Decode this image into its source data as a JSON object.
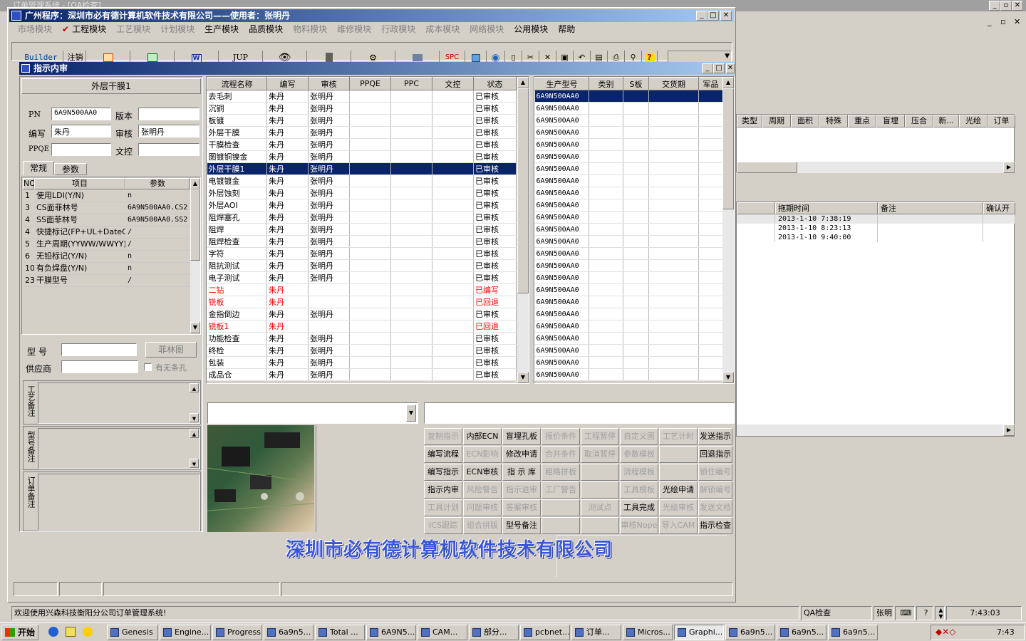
{
  "bg_title": "订单管理系统 - [QA检查]",
  "main_title": "广州程序：深圳市必有德计算机软件技术有限公司——使用者：张明丹",
  "menu": [
    {
      "label": "市场模块",
      "en": false
    },
    {
      "label": "工程模块",
      "en": true
    },
    {
      "label": "工艺模块",
      "en": false
    },
    {
      "label": "计划模块",
      "en": false
    },
    {
      "label": "生产模块",
      "en": true
    },
    {
      "label": "品质模块",
      "en": true
    },
    {
      "label": "物料模块",
      "en": false
    },
    {
      "label": "维修模块",
      "en": false
    },
    {
      "label": "行政模块",
      "en": false
    },
    {
      "label": "成本模块",
      "en": false
    },
    {
      "label": "网络模块",
      "en": false
    },
    {
      "label": "公用模块",
      "en": true
    },
    {
      "label": "帮助",
      "en": true
    }
  ],
  "toolbar": {
    "builder": "Builder",
    "logout": "注销",
    "w": "W",
    "jup": "JUP",
    "spc": "SPC"
  },
  "child_title": "指示内审",
  "left": {
    "header": "外层干膜1",
    "pn_label": "PN",
    "pn_value": "6A9N500AA0",
    "version_label": "版本",
    "version_value": "",
    "writer_label": "编写",
    "writer_value": "朱丹",
    "audit_label": "审核",
    "audit_value": "张明丹",
    "ppqe_label": "PPQE",
    "ppqe_value": "",
    "wenkong_label": "文控",
    "wenkong_value": "",
    "tab1": "常规",
    "tab2": "参数",
    "param_headers": [
      "NO",
      "项目",
      "参数"
    ],
    "params": [
      [
        "1",
        "使用LDI(Y/N)",
        "n"
      ],
      [
        "3",
        "CS面菲林号",
        "6A9N500AA0.CS2"
      ],
      [
        "4",
        "SS面菲林号",
        "6A9N500AA0.SS2"
      ],
      [
        "4",
        "快捷标记(FP+UL+DateC/",
        "/"
      ],
      [
        "5",
        "生产周期(YYWW/WWYY)",
        "/"
      ],
      [
        "6",
        "无铅标记(Y/N)",
        "n"
      ],
      [
        "10",
        "有负焊盘(Y/N)",
        "n"
      ],
      [
        "23",
        "干膜型号",
        "/"
      ]
    ],
    "model_label": "型 号",
    "film_btn": "菲林图",
    "supplier_label": "供应商",
    "slot_label": "有无条孔",
    "note1": "工艺备注",
    "note2": "型号备注",
    "note3": "订单备注"
  },
  "flow": {
    "headers": [
      "流程名称",
      "编写",
      "审核",
      "PPQE",
      "PPC",
      "文控",
      "状态"
    ],
    "rows": [
      [
        "去毛刺",
        "朱丹",
        "张明丹",
        "",
        "",
        "",
        "已审核"
      ],
      [
        "沉铜",
        "朱丹",
        "张明丹",
        "",
        "",
        "",
        "已审核"
      ],
      [
        "板镀",
        "朱丹",
        "张明丹",
        "",
        "",
        "",
        "已审核"
      ],
      [
        "外层干膜",
        "朱丹",
        "张明丹",
        "",
        "",
        "",
        "已审核"
      ],
      [
        "干膜检查",
        "朱丹",
        "张明丹",
        "",
        "",
        "",
        "已审核"
      ],
      [
        "图镀铜镍金",
        "朱丹",
        "张明丹",
        "",
        "",
        "",
        "已审核"
      ],
      [
        "外层干膜1",
        "朱丹",
        "张明丹",
        "",
        "",
        "",
        "已审核"
      ],
      [
        "电镀镀金",
        "朱丹",
        "张明丹",
        "",
        "",
        "",
        "已审核"
      ],
      [
        "外层蚀刻",
        "朱丹",
        "张明丹",
        "",
        "",
        "",
        "已审核"
      ],
      [
        "外层AOI",
        "朱丹",
        "张明丹",
        "",
        "",
        "",
        "已审核"
      ],
      [
        "阻焊塞孔",
        "朱丹",
        "张明丹",
        "",
        "",
        "",
        "已审核"
      ],
      [
        "阻焊",
        "朱丹",
        "张明丹",
        "",
        "",
        "",
        "已审核"
      ],
      [
        "阻焊检查",
        "朱丹",
        "张明丹",
        "",
        "",
        "",
        "已审核"
      ],
      [
        "字符",
        "朱丹",
        "张明丹",
        "",
        "",
        "",
        "已审核"
      ],
      [
        "阻抗测试",
        "朱丹",
        "张明丹",
        "",
        "",
        "",
        "已审核"
      ],
      [
        "电子测试",
        "朱丹",
        "张明丹",
        "",
        "",
        "",
        "已审核"
      ],
      [
        "二钻",
        "朱丹",
        "",
        "",
        "",
        "",
        "已编写"
      ],
      [
        "铣板",
        "朱丹",
        "",
        "",
        "",
        "",
        "已回退"
      ],
      [
        "金指倒边",
        "朱丹",
        "张明丹",
        "",
        "",
        "",
        "已审核"
      ],
      [
        "铣板1",
        "朱丹",
        "",
        "",
        "",
        "",
        "已回退"
      ],
      [
        "功能检查",
        "朱丹",
        "张明丹",
        "",
        "",
        "",
        "已审核"
      ],
      [
        "终检",
        "朱丹",
        "张明丹",
        "",
        "",
        "",
        "已审核"
      ],
      [
        "包装",
        "朱丹",
        "张明丹",
        "",
        "",
        "",
        "已审核"
      ],
      [
        "成品仓",
        "朱丹",
        "张明丹",
        "",
        "",
        "",
        "已审核"
      ]
    ],
    "selected": 6,
    "red_rows": [
      16,
      17,
      19
    ]
  },
  "prod": {
    "headers": [
      "生产型号",
      "类别",
      "S板",
      "交货期",
      "军品"
    ],
    "model": "6A9N500AA0",
    "count": 24
  },
  "actions": [
    [
      {
        "t": "复制指示",
        "d": true
      },
      {
        "t": "内部ECN",
        "d": false
      },
      {
        "t": "盲埋孔板",
        "d": false
      },
      {
        "t": "报价条件",
        "d": true
      },
      {
        "t": "工程暂停",
        "d": true
      },
      {
        "t": "自定义图",
        "d": true
      },
      {
        "t": "工艺计时",
        "d": true
      },
      {
        "t": "发送指示",
        "d": false
      }
    ],
    [
      {
        "t": "编写流程",
        "d": false
      },
      {
        "t": "ECN影响",
        "d": true
      },
      {
        "t": "修改申请",
        "d": false
      },
      {
        "t": "合并条件",
        "d": true
      },
      {
        "t": "取消暂停",
        "d": true
      },
      {
        "t": "参数模板",
        "d": true
      },
      {
        "t": "",
        "d": true
      },
      {
        "t": "回退指示",
        "d": false
      }
    ],
    [
      {
        "t": "编写指示",
        "d": false
      },
      {
        "t": "ECN审核",
        "d": false
      },
      {
        "t": "指 示 库",
        "d": false
      },
      {
        "t": "粗略拼板",
        "d": true
      },
      {
        "t": "",
        "d": true
      },
      {
        "t": "流程模板",
        "d": true
      },
      {
        "t": "",
        "d": true
      },
      {
        "t": "锁住编号",
        "d": true
      }
    ],
    [
      {
        "t": "指示内审",
        "d": false
      },
      {
        "t": "风险警告",
        "d": true
      },
      {
        "t": "指示退审",
        "d": true
      },
      {
        "t": "工厂警告",
        "d": true
      },
      {
        "t": "",
        "d": true
      },
      {
        "t": "工具模板",
        "d": true
      },
      {
        "t": "光绘申请",
        "d": false
      },
      {
        "t": "解锁编号",
        "d": true
      }
    ],
    [
      {
        "t": "工具计划",
        "d": true
      },
      {
        "t": "问题审核",
        "d": true
      },
      {
        "t": "答案审核",
        "d": true
      },
      {
        "t": "",
        "d": true
      },
      {
        "t": "测试点",
        "d": true
      },
      {
        "t": "工具完成",
        "d": false
      },
      {
        "t": "光绘审核",
        "d": true
      },
      {
        "t": "发送文档",
        "d": true
      }
    ],
    [
      {
        "t": "ICS跟踪",
        "d": true
      },
      {
        "t": "组合拼版",
        "d": true
      },
      {
        "t": "型号备注",
        "d": false
      },
      {
        "t": "",
        "d": true
      },
      {
        "t": "",
        "d": true
      },
      {
        "t": "审核Nope",
        "d": true
      },
      {
        "t": "导入CAM",
        "d": true
      },
      {
        "t": "指示检查",
        "d": false
      }
    ]
  ],
  "company_banner": "深圳市必有德计算机软件技术有限公司",
  "bg_grid": {
    "headers": [
      "类型",
      "周期",
      "面积",
      "特殊",
      "重点",
      "盲埋",
      "压合",
      "新...",
      "光绘",
      "订单"
    ],
    "headers2": [
      "",
      "拖期时间",
      "备注",
      "确认开"
    ],
    "rows": [
      [
        "",
        "2013-1-10 7:38:19",
        "",
        ""
      ],
      [
        "",
        "2013-1-10 8:23:13",
        "",
        ""
      ],
      [
        "",
        "2013-1-10 9:40:00",
        "",
        ""
      ]
    ]
  },
  "status": {
    "welcome": "欢迎使用兴森科技衡阳分公司订单管理系统!",
    "qa": "QA检查",
    "user": "张明",
    "time": "7:43:03"
  },
  "taskbar": {
    "start": "开始",
    "items": [
      "Genesis",
      "Engine...",
      "Progress",
      "6a9n5...",
      "Total ...",
      "6A9N5...",
      "CAM...",
      "部分...",
      "pcbnet...",
      "订单...",
      "Micros...",
      "Graphi...",
      "6a9n5...",
      "6a9n5...",
      "6a9n5..."
    ],
    "active": 11,
    "clock": "7:43"
  }
}
